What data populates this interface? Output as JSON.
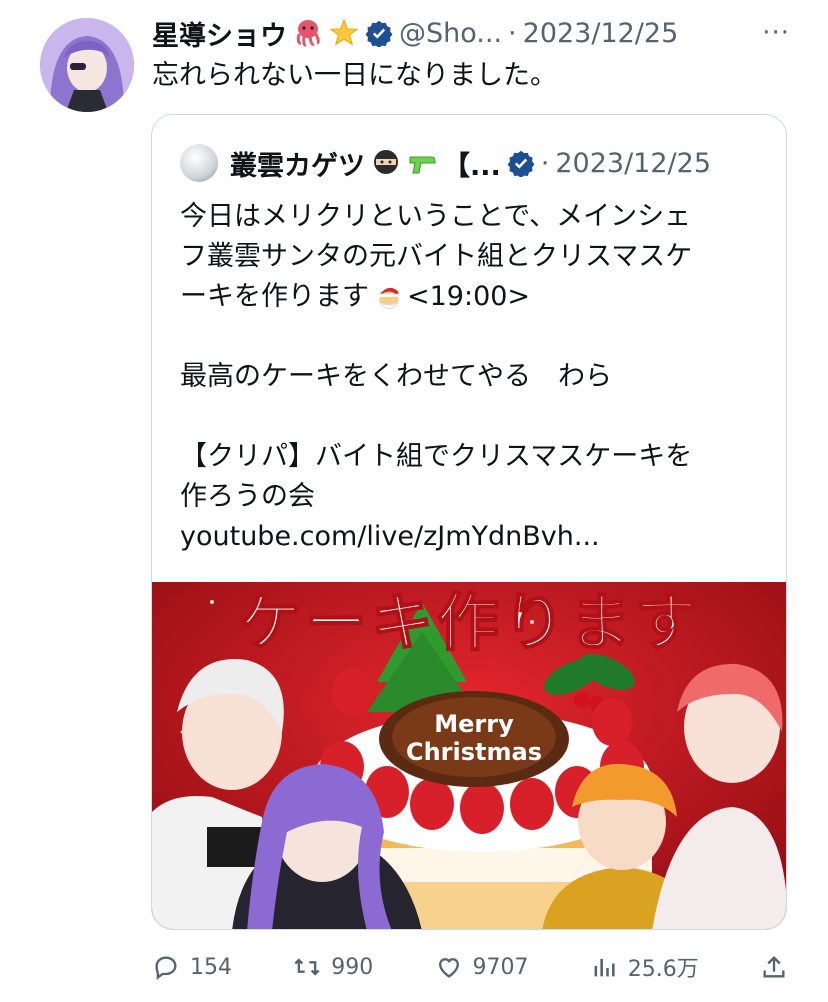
{
  "tweet": {
    "author_name": "星導ショウ",
    "handle": "@Sho...",
    "separator": "·",
    "date": "2023/12/25",
    "more_label": "···",
    "text": "忘れられない一日になりました。",
    "emojis": [
      "octopus-emoji",
      "star-emoji"
    ]
  },
  "quote": {
    "author_name": "叢雲カゲツ",
    "name_suffix": "【...",
    "separator": "·",
    "date": "2023/12/25",
    "lines": [
      "今日はメリクリということで、メインシェ",
      "フ叢雲サンタの元バイト組とクリスマスケ",
      "ーキを作ります",
      "<19:00>",
      "最高のケーキをくわせてやる　わら",
      "【クリパ】バイト組でクリスマスケーキを",
      "作ろうの会",
      "youtube.com/live/zJmYdnBvh..."
    ],
    "media": {
      "banner_text": "ケーキ作ります",
      "plate_text_1": "Merry",
      "plate_text_2": "Christmas"
    }
  },
  "actions": {
    "replies": "154",
    "retweets": "990",
    "likes": "9707",
    "views": "25.6万"
  },
  "colors": {
    "verified": "#1d9bf0",
    "muted": "#536471",
    "border": "#cfd9de",
    "banner_red": "#c8161d"
  }
}
